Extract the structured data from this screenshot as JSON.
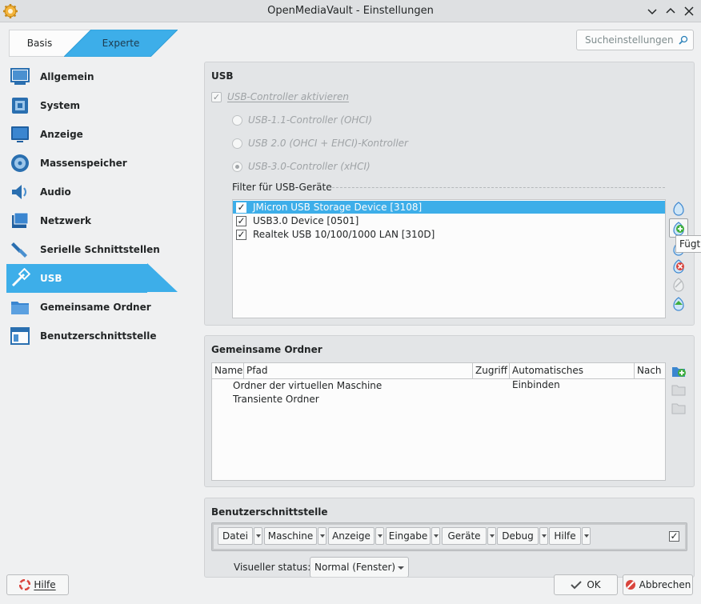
{
  "window": {
    "title": "OpenMediaVault - Einstellungen"
  },
  "modes": {
    "basic": "Basis",
    "expert": "Experte"
  },
  "search": {
    "placeholder": "Sucheinstellungen"
  },
  "sidebar": {
    "items": [
      {
        "label": "Allgemein",
        "icon": "general-icon"
      },
      {
        "label": "System",
        "icon": "system-icon"
      },
      {
        "label": "Anzeige",
        "icon": "display-icon"
      },
      {
        "label": "Massenspeicher",
        "icon": "storage-icon"
      },
      {
        "label": "Audio",
        "icon": "audio-icon"
      },
      {
        "label": "Netzwerk",
        "icon": "network-icon"
      },
      {
        "label": "Serielle Schnittstellen",
        "icon": "serial-ports-icon"
      },
      {
        "label": "USB",
        "icon": "usb-icon",
        "selected": true
      },
      {
        "label": "Gemeinsame Ordner",
        "icon": "shared-folders-icon"
      },
      {
        "label": "Benutzerschnittstelle",
        "icon": "user-interface-icon"
      }
    ]
  },
  "usb": {
    "title": "USB",
    "enable_label": "USB-Controller aktivieren",
    "enable_checked": true,
    "controllers": [
      {
        "label": "USB-1.1-Controller (OHCI)",
        "selected": false
      },
      {
        "label": "USB 2.0 (OHCI + EHCI)-Kontroller",
        "selected": false
      },
      {
        "label": "USB-3.0-Controller (xHCI)",
        "selected": true
      }
    ],
    "filters_label": "Filter für USB-Geräte",
    "filters": [
      {
        "label": "JMicron USB Storage Device [3108]",
        "checked": true,
        "selected": true
      },
      {
        "label": "USB3.0 Device [0501]",
        "checked": true,
        "selected": false
      },
      {
        "label": "Realtek USB 10/100/1000 LAN [310D]",
        "checked": true,
        "selected": false
      }
    ],
    "tooltip": "Fügt"
  },
  "shared": {
    "title": "Gemeinsame Ordner",
    "columns": [
      "Name",
      "Pfad",
      "Zugriff",
      "Automatisches Einbinden",
      "Nach"
    ],
    "rows": [
      "Ordner der virtuellen Maschine",
      "Transiente Ordner"
    ]
  },
  "ui": {
    "title": "Benutzerschnittstelle",
    "menus": [
      "Datei",
      "Maschine",
      "Anzeige",
      "Eingabe",
      "Geräte",
      "Debug",
      "Hilfe"
    ],
    "menubar_enabled": true,
    "visual_state_label": "Visueller status:",
    "visual_state_value": "Normal (Fenster)"
  },
  "footer": {
    "help": "Hilfe",
    "ok": "OK",
    "cancel": "Abbrechen"
  },
  "colors": {
    "accent": "#3daee9",
    "background": "#eff0f1",
    "group": "#e3e5e7"
  }
}
